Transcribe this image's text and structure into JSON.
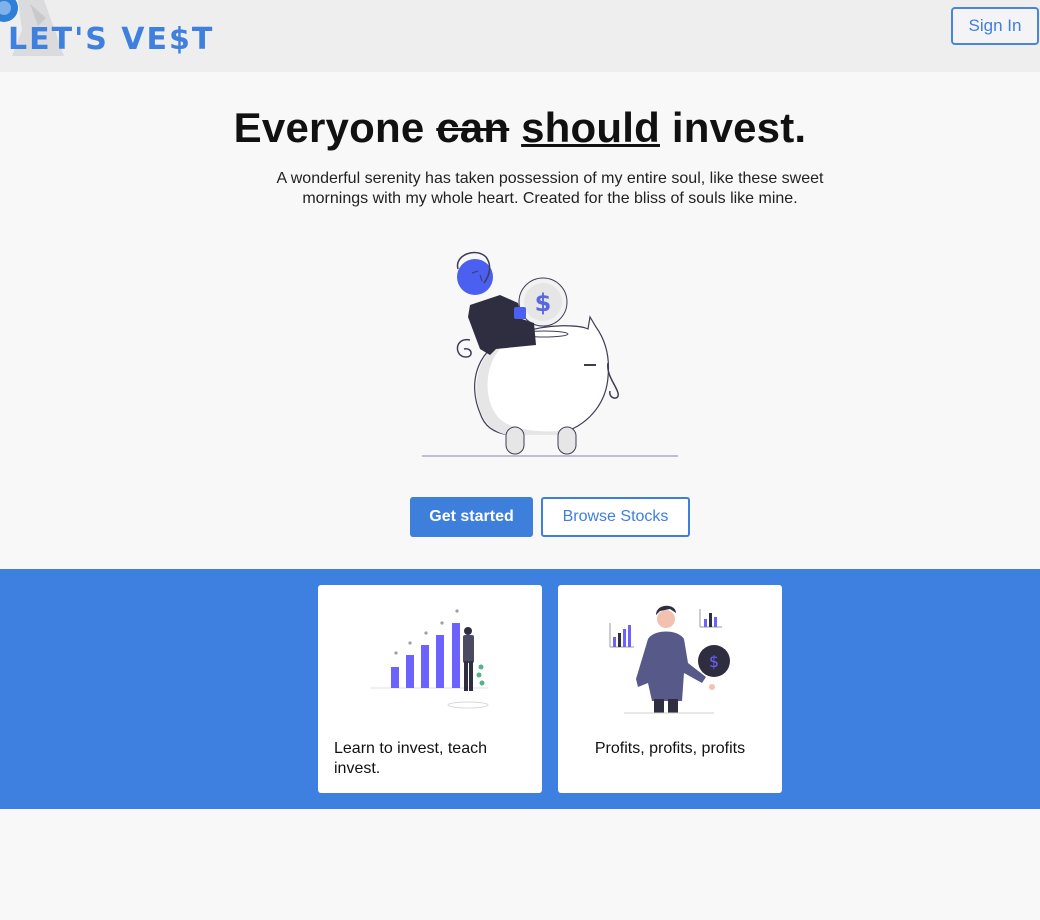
{
  "header": {
    "logo_text": "LET'S VE$T",
    "signin_label": "Sign In"
  },
  "hero": {
    "title_part1": "Everyone",
    "title_strike": "can",
    "title_under": "should",
    "title_part2": "invest.",
    "subtitle": "A wonderful serenity has taken possession of my entire soul, like these sweet mornings with my whole heart. Created for the bliss of souls like mine.",
    "coin_symbol": "$"
  },
  "actions": {
    "primary_label": "Get started",
    "secondary_label": "Browse Stocks"
  },
  "features": [
    {
      "text": "Learn to invest, teach invest.",
      "icon": "growth-chart-illustration"
    },
    {
      "text": "Profits, profits, profits",
      "icon": "investor-illustration",
      "coin_symbol": "$"
    }
  ],
  "colors": {
    "brand": "#3e80df",
    "accent_purple": "#6c63ff",
    "dark": "#2f2e41"
  }
}
